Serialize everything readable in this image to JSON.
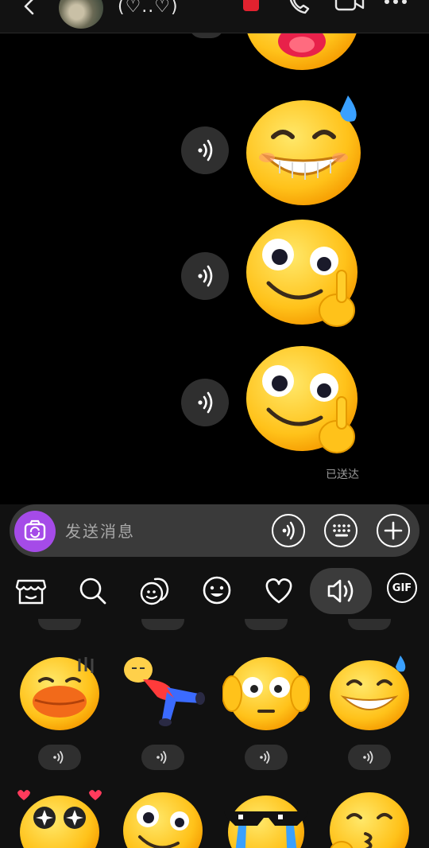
{
  "header": {
    "title": "(♡..♡)",
    "back_icon": "chevron-left-icon",
    "icons": [
      "phone-badge-icon",
      "call-icon",
      "video-icon",
      "more-icon"
    ]
  },
  "chat": {
    "messages": [
      {
        "type": "sticker",
        "sticker": "sweat-grin-emoji",
        "voice": true
      },
      {
        "type": "sticker",
        "sticker": "thinking-smile-emoji",
        "voice": true
      },
      {
        "type": "sticker",
        "sticker": "thinking-smile-emoji",
        "voice": true
      }
    ],
    "status": "已送达"
  },
  "input": {
    "placeholder": "发送消息",
    "camera_icon": "camera-icon",
    "buttons": [
      "voice-icon",
      "keyboard-icon",
      "plus-icon"
    ]
  },
  "tabs": [
    {
      "name": "sticker-store-icon"
    },
    {
      "name": "search-icon"
    },
    {
      "name": "camera-sticker-icon"
    },
    {
      "name": "emoji-icon"
    },
    {
      "name": "heart-icon"
    },
    {
      "name": "sound-icon",
      "active": true
    },
    {
      "name": "gif-icon",
      "label": "GIF"
    }
  ],
  "panel": {
    "row1": [
      "duck-mouth-emoji",
      "fallen-person-emoji",
      "ears-covered-emoji",
      "sweat-grin-emoji"
    ],
    "row2": [
      "starry-eyes-emoji",
      "thinking-smile-emoji",
      "sunglasses-crying-emoji",
      "kissing-emoji"
    ]
  },
  "colors": {
    "accent": "#a54be8",
    "background": "#000000",
    "phone_badge": "#e2222f"
  }
}
